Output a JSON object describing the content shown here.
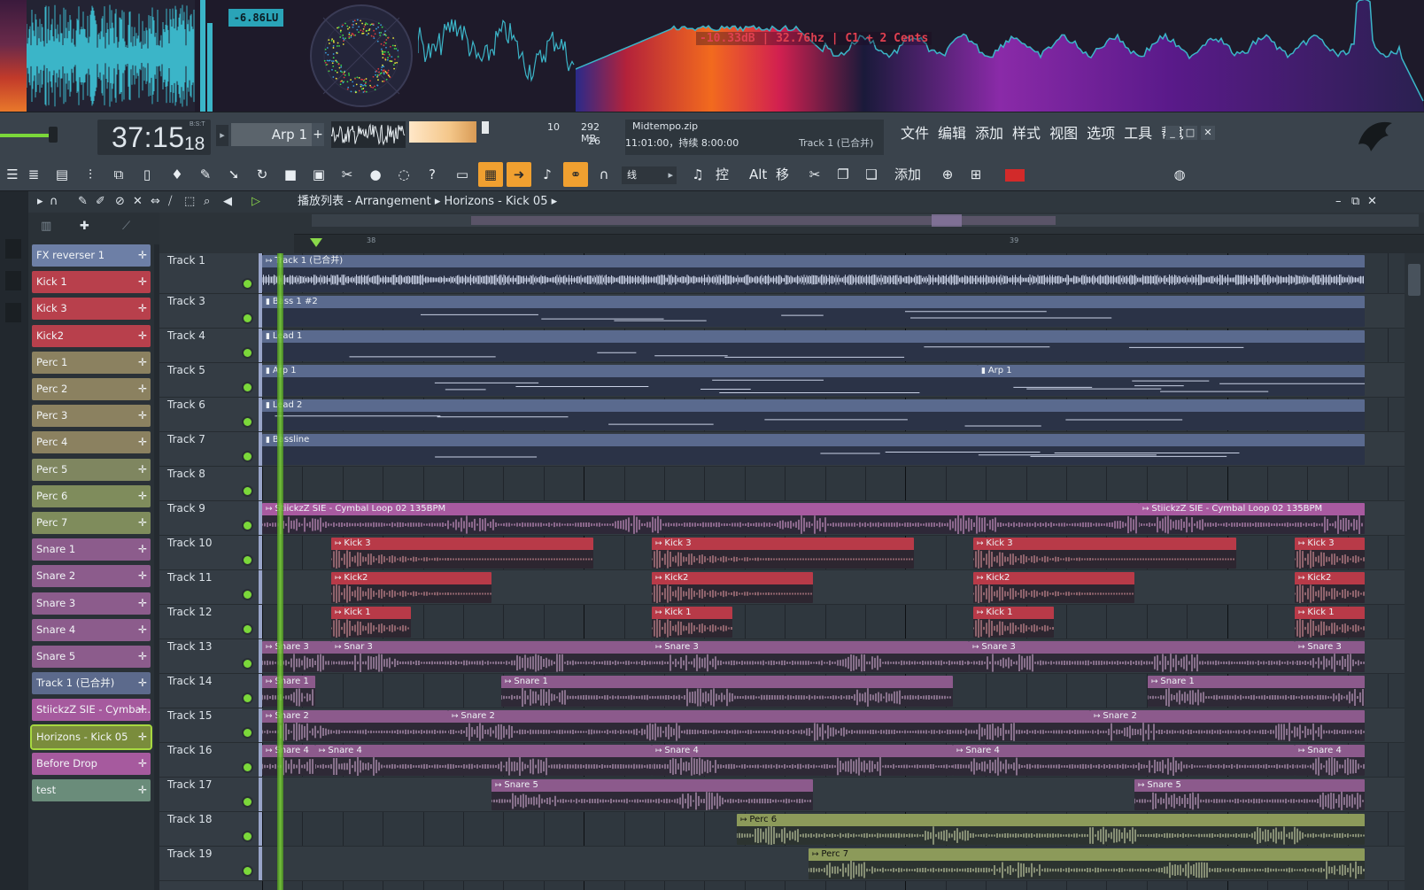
{
  "visualizer": {
    "lufs": "-6.86LU",
    "readout": "-10.33dB | 32.76hz | C1 + 2 Cents"
  },
  "transport": {
    "time_main": "37:15",
    "time_sub": "18",
    "time_unit": "B:S:T",
    "pattern": "Arp 1",
    "pattern_add": "+",
    "cpu_value": "10",
    "mem_value": "292 MB",
    "voices": "26",
    "hint_line1": "Midtempo.zip",
    "hint_line2": "11:01:00，持续 8:00:00",
    "hint_line3": "Track 1 (已合并)"
  },
  "menu": [
    "文件",
    "编辑",
    "添加",
    "样式",
    "视图",
    "选项",
    "工具",
    "帮助"
  ],
  "window_buttons": [
    "_",
    "□",
    "✕"
  ],
  "toolbar": {
    "snap_label": "线",
    "ctrl_label": "控",
    "alt_label": "Alt",
    "move_label": "移",
    "add_label": "添加"
  },
  "playlist": {
    "title": "播放列表 - Arrangement ▸ Horizons - Kick 05 ▸",
    "ruler_marks": [
      "38",
      "39"
    ],
    "close_buttons": [
      "–",
      "⧉",
      "✕"
    ]
  },
  "picker": [
    {
      "name": "FX reverser 1",
      "color": "#6d7fa6"
    },
    {
      "name": "Kick 1",
      "color": "#b8404c"
    },
    {
      "name": "Kick 3",
      "color": "#b8404c"
    },
    {
      "name": "Kick2",
      "color": "#b8404c"
    },
    {
      "name": "Perc 1",
      "color": "#8b8160"
    },
    {
      "name": "Perc 2",
      "color": "#8b8160"
    },
    {
      "name": "Perc 3",
      "color": "#8b8160"
    },
    {
      "name": "Perc 4",
      "color": "#8b8160"
    },
    {
      "name": "Perc 5",
      "color": "#7f8660"
    },
    {
      "name": "Perc 6",
      "color": "#7f8c5c"
    },
    {
      "name": "Perc 7",
      "color": "#7f8c5c"
    },
    {
      "name": "Snare 1",
      "color": "#8c5c8c"
    },
    {
      "name": "Snare 2",
      "color": "#8c5c8c"
    },
    {
      "name": "Snare 3",
      "color": "#8c5c8c"
    },
    {
      "name": "Snare 4",
      "color": "#8c5c8c"
    },
    {
      "name": "Snare 5",
      "color": "#8c5c8c"
    },
    {
      "name": "Track 1 (已合并)",
      "color": "#5c6a8c"
    },
    {
      "name": "StiickzZ SIE - Cymbal...",
      "color": "#a65a9e"
    },
    {
      "name": "Horizons - Kick 05",
      "color": "#7a8c3c"
    },
    {
      "name": "Before Drop",
      "color": "#a65a9e"
    },
    {
      "name": "test",
      "color": "#6a8c7a"
    }
  ],
  "tracks": [
    "Track 1",
    "Track 3",
    "Track 4",
    "Track 5",
    "Track 6",
    "Track 7",
    "Track 8",
    "Track 9",
    "Track 10",
    "Track 11",
    "Track 12",
    "Track 13",
    "Track 14",
    "Track 15",
    "Track 16",
    "Track 17",
    "Track 18",
    "Track 19"
  ],
  "clips": [
    {
      "track": 0,
      "name": "Track 1 (已合并)",
      "kind": "audio",
      "color": "blue",
      "start": 0,
      "end": 1245
    },
    {
      "track": 1,
      "name": "Bass 1 #2",
      "kind": "pat",
      "color": "blue",
      "start": 0,
      "end": 1245
    },
    {
      "track": 2,
      "name": "Lead 1",
      "kind": "pat",
      "color": "blue",
      "start": 0,
      "end": 1245
    },
    {
      "track": 3,
      "name": "Arp 1",
      "kind": "pat",
      "color": "blue",
      "start": 0,
      "end": 808
    },
    {
      "track": 3,
      "name": "Arp 1",
      "kind": "pat",
      "color": "blue",
      "start": 808,
      "end": 1245
    },
    {
      "track": 4,
      "name": "Lead 2",
      "kind": "pat",
      "color": "blue",
      "start": 0,
      "end": 1245
    },
    {
      "track": 5,
      "name": "Bassline",
      "kind": "pat",
      "color": "blue",
      "start": 0,
      "end": 1245
    },
    {
      "track": 7,
      "name": "StiickzZ SIE - Cymbal Loop 02 135BPM",
      "kind": "audio",
      "color": "pink",
      "start": 0,
      "end": 990
    },
    {
      "track": 7,
      "name": "StiickzZ SIE - Cymbal Loop 02 135BPM",
      "kind": "audio",
      "color": "pink",
      "start": 990,
      "end": 1245
    },
    {
      "track": 8,
      "name": "Kick 3",
      "kind": "audio",
      "color": "red",
      "start": 78,
      "end": 374
    },
    {
      "track": 8,
      "name": "Kick 3",
      "kind": "audio",
      "color": "red",
      "start": 440,
      "end": 736
    },
    {
      "track": 8,
      "name": "Kick 3",
      "kind": "audio",
      "color": "red",
      "start": 803,
      "end": 1100
    },
    {
      "track": 8,
      "name": "Kick 3",
      "kind": "audio",
      "color": "red",
      "start": 1166,
      "end": 1245
    },
    {
      "track": 9,
      "name": "Kick2",
      "kind": "audio",
      "color": "red",
      "start": 78,
      "end": 259
    },
    {
      "track": 9,
      "name": "Kick2",
      "kind": "audio",
      "color": "red",
      "start": 440,
      "end": 622
    },
    {
      "track": 9,
      "name": "Kick2",
      "kind": "audio",
      "color": "red",
      "start": 803,
      "end": 985
    },
    {
      "track": 9,
      "name": "Kick2",
      "kind": "audio",
      "color": "red",
      "start": 1166,
      "end": 1245
    },
    {
      "track": 10,
      "name": "Kick 1",
      "kind": "audio",
      "color": "red",
      "start": 78,
      "end": 168
    },
    {
      "track": 10,
      "name": "Kick 1",
      "kind": "audio",
      "color": "red",
      "start": 440,
      "end": 531
    },
    {
      "track": 10,
      "name": "Kick 1",
      "kind": "audio",
      "color": "red",
      "start": 803,
      "end": 894
    },
    {
      "track": 10,
      "name": "Kick 1",
      "kind": "audio",
      "color": "red",
      "start": 1166,
      "end": 1245
    },
    {
      "track": 11,
      "name": "Snare 3",
      "kind": "audio",
      "color": "mauve",
      "start": 0,
      "end": 78
    },
    {
      "track": 11,
      "name": "Snar 3",
      "kind": "audio",
      "color": "mauve",
      "start": 78,
      "end": 440
    },
    {
      "track": 11,
      "name": "Snare 3",
      "kind": "audio",
      "color": "mauve",
      "start": 440,
      "end": 798
    },
    {
      "track": 11,
      "name": "Snare 3",
      "kind": "audio",
      "color": "mauve",
      "start": 798,
      "end": 1166
    },
    {
      "track": 11,
      "name": "Snare 3",
      "kind": "audio",
      "color": "mauve",
      "start": 1166,
      "end": 1245
    },
    {
      "track": 12,
      "name": "Snare 1",
      "kind": "audio",
      "color": "mauve",
      "start": 0,
      "end": 60
    },
    {
      "track": 12,
      "name": "Snare 1",
      "kind": "audio",
      "color": "mauve",
      "start": 270,
      "end": 780
    },
    {
      "track": 12,
      "name": "Snare 1",
      "kind": "audio",
      "color": "mauve",
      "start": 1000,
      "end": 1245
    },
    {
      "track": 13,
      "name": "Snare 2",
      "kind": "audio",
      "color": "mauve",
      "start": 0,
      "end": 210
    },
    {
      "track": 13,
      "name": "Snare 2",
      "kind": "audio",
      "color": "mauve",
      "start": 210,
      "end": 935
    },
    {
      "track": 13,
      "name": "Snare 2",
      "kind": "audio",
      "color": "mauve",
      "start": 935,
      "end": 1245
    },
    {
      "track": 14,
      "name": "Snare 4",
      "kind": "audio",
      "color": "mauve",
      "start": 0,
      "end": 60
    },
    {
      "track": 14,
      "name": "Snare 4",
      "kind": "audio",
      "color": "mauve",
      "start": 60,
      "end": 440
    },
    {
      "track": 14,
      "name": "Snare 4",
      "kind": "audio",
      "color": "mauve",
      "start": 440,
      "end": 780
    },
    {
      "track": 14,
      "name": "Snare 4",
      "kind": "audio",
      "color": "mauve",
      "start": 780,
      "end": 1166
    },
    {
      "track": 14,
      "name": "Snare 4",
      "kind": "audio",
      "color": "mauve",
      "start": 1166,
      "end": 1245
    },
    {
      "track": 15,
      "name": "Snare 5",
      "kind": "audio",
      "color": "mauve",
      "start": 259,
      "end": 622
    },
    {
      "track": 15,
      "name": "Snare 5",
      "kind": "audio",
      "color": "mauve",
      "start": 985,
      "end": 1245
    },
    {
      "track": 16,
      "name": "Perc 6",
      "kind": "audio",
      "color": "olive",
      "start": 536,
      "end": 1245
    },
    {
      "track": 17,
      "name": "Perc 7",
      "kind": "audio",
      "color": "olive",
      "start": 617,
      "end": 1245
    }
  ]
}
